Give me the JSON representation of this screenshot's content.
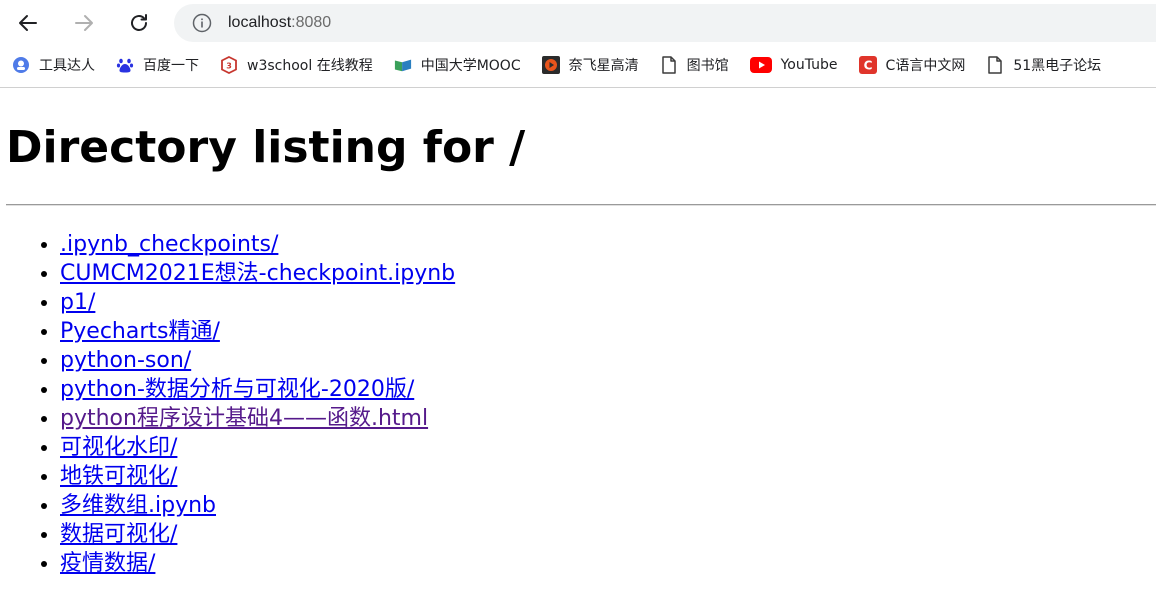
{
  "browser": {
    "url_host": "localhost",
    "url_port": ":8080",
    "bookmarks": [
      {
        "label": "工具达人",
        "icon": "tool-master-icon"
      },
      {
        "label": "百度一下",
        "icon": "baidu-paw-icon"
      },
      {
        "label": "w3school 在线教程",
        "icon": "w3school-icon"
      },
      {
        "label": "中国大学MOOC",
        "icon": "mooc-icon"
      },
      {
        "label": "奈飞星高清",
        "icon": "play-icon"
      },
      {
        "label": "图书馆",
        "icon": "document-icon"
      },
      {
        "label": "YouTube",
        "icon": "youtube-icon"
      },
      {
        "label": "C语言中文网",
        "icon": "c-language-icon"
      },
      {
        "label": "51黑电子论坛",
        "icon": "document-icon"
      }
    ]
  },
  "page": {
    "title": "Directory listing for /",
    "entries": [
      {
        "name": ".ipynb_checkpoints/",
        "visited": false
      },
      {
        "name": "CUMCM2021E想法-checkpoint.ipynb",
        "visited": false
      },
      {
        "name": "p1/",
        "visited": false
      },
      {
        "name": "Pyecharts精通/",
        "visited": false
      },
      {
        "name": "python-son/",
        "visited": false
      },
      {
        "name": "python-数据分析与可视化-2020版/",
        "visited": false
      },
      {
        "name": "python程序设计基础4——函数.html",
        "visited": true
      },
      {
        "name": "可视化水印/",
        "visited": false
      },
      {
        "name": "地铁可视化/",
        "visited": false
      },
      {
        "name": "多维数组.ipynb",
        "visited": false
      },
      {
        "name": "数据可视化/",
        "visited": false
      },
      {
        "name": "疫情数据/",
        "visited": false
      }
    ]
  },
  "colors": {
    "link": "#0000ee",
    "visited_link": "#551a8b",
    "youtube_red": "#ff0000",
    "c_lang_red": "#e0352b"
  }
}
